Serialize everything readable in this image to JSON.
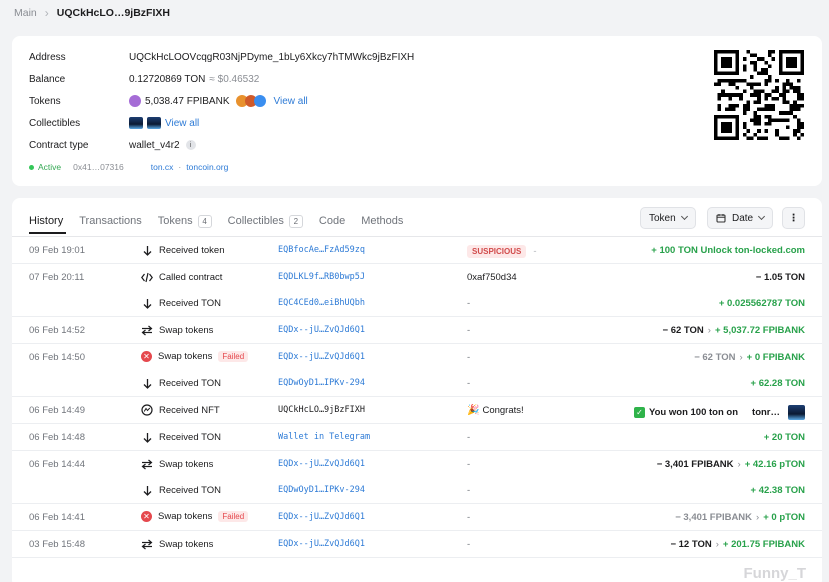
{
  "breadcrumb": {
    "main": "Main",
    "current": "UQCkHcLO…9jBzFIXH"
  },
  "account": {
    "address_label": "Address",
    "address": "UQCkHcLOOVcqgR03NjPDyme_1bLy6Xkcy7hTMWkc9jBzFIXH",
    "balance_label": "Balance",
    "balance": "0.12720869 TON",
    "balance_usd": "≈ $0.46532",
    "tokens_label": "Tokens",
    "tokens_value": "5,038.47 FPIBANK",
    "tokens_view_all": "View all",
    "collectibles_label": "Collectibles",
    "collectibles_view_all": "View all",
    "contract_label": "Contract type",
    "contract_value": "wallet_v4r2",
    "status": "Active",
    "state_hash": "0x41…07316",
    "explorer1": "ton.cx",
    "explorer_sep": "·",
    "explorer2": "toncoin.org"
  },
  "tabs": [
    {
      "label": "History"
    },
    {
      "label": "Transactions"
    },
    {
      "label": "Tokens",
      "count": "4"
    },
    {
      "label": "Collectibles",
      "count": "2"
    },
    {
      "label": "Code"
    },
    {
      "label": "Methods"
    }
  ],
  "controls": {
    "token_filter": "Token",
    "date_filter": "Date",
    "more": "⋮"
  },
  "colors": {
    "positive": "#27a14a",
    "failed": "#e5484d",
    "link": "#2e7bd6"
  },
  "history": [
    {
      "date": "09 Feb 19:01",
      "lines": [
        {
          "icon": "arrow-down-icon",
          "action": "Received token",
          "peer": "EQBfocAe…FzAd59zq",
          "note": "SUSPICIOUS",
          "note_type": "suspicious",
          "amount": "+ 100 TON Unlock ton-locked.com"
        }
      ]
    },
    {
      "date": "07 Feb 20:11",
      "lines": [
        {
          "icon": "code-icon",
          "action": "Called contract",
          "peer": "EQDLKL9f…RB0bwp5J",
          "note": "0xaf750d34",
          "note_type": "dark",
          "amount_neg": "− 1.05 TON"
        },
        {
          "icon": "arrow-down-icon",
          "action": "Received TON",
          "peer": "EQC4CEd0…eiBhUQbh",
          "note": "-",
          "amount": "+ 0.025562787 TON"
        }
      ]
    },
    {
      "date": "06 Feb 14:52",
      "lines": [
        {
          "icon": "swap-icon",
          "action": "Swap tokens",
          "peer": "EQDx--jU…ZvQJd6Q1",
          "note": "-",
          "amount_neg": "− 62 TON",
          "amount": "+ 5,037.72 FPIBANK"
        }
      ]
    },
    {
      "date": "06 Feb 14:50",
      "lines": [
        {
          "icon": "fail",
          "action": "Swap tokens",
          "failed": "Failed",
          "peer": "EQDx--jU…ZvQJd6Q1",
          "note": "-",
          "amount_gray": "− 62 TON",
          "amount": "+ 0 FPIBANK"
        },
        {
          "icon": "arrow-down-icon",
          "action": "Received TON",
          "peer": "EQDwOyD1…IPKv-294",
          "note": "-",
          "amount": "+ 62.28 TON"
        }
      ]
    },
    {
      "date": "06 Feb 14:49",
      "lines": [
        {
          "icon": "nft-icon",
          "action": "Received NFT",
          "peer": "UQCkHcLO…9jBzFIXH",
          "peer_dark": true,
          "note": "Congrats!",
          "note_type": "congrats",
          "nft_text": "You won 100 ton on",
          "nft_text2": "tonr…"
        }
      ]
    },
    {
      "date": "06 Feb 14:48",
      "lines": [
        {
          "icon": "arrow-down-icon",
          "action": "Received TON",
          "peer": "Wallet in Telegram",
          "note": "-",
          "amount": "+ 20 TON"
        }
      ]
    },
    {
      "date": "06 Feb 14:44",
      "lines": [
        {
          "icon": "swap-icon",
          "action": "Swap tokens",
          "peer": "EQDx--jU…ZvQJd6Q1",
          "note": "-",
          "amount_neg": "− 3,401 FPIBANK",
          "amount": "+ 42.16 pTON"
        },
        {
          "icon": "arrow-down-icon",
          "action": "Received TON",
          "peer": "EQDwOyD1…IPKv-294",
          "note": "-",
          "amount": "+ 42.38 TON"
        }
      ]
    },
    {
      "date": "06 Feb 14:41",
      "lines": [
        {
          "icon": "fail",
          "action": "Swap tokens",
          "failed": "Failed",
          "peer": "EQDx--jU…ZvQJd6Q1",
          "note": "-",
          "amount_gray": "− 3,401 FPIBANK",
          "amount": "+ 0 pTON"
        }
      ]
    },
    {
      "date": "03 Feb 15:48",
      "lines": [
        {
          "icon": "swap-icon",
          "action": "Swap tokens",
          "peer": "EQDx--jU…ZvQJd6Q1",
          "note": "-",
          "amount_neg": "− 12 TON",
          "amount": "+ 201.75 FPIBANK"
        }
      ]
    }
  ],
  "watermark": "Funny_T"
}
